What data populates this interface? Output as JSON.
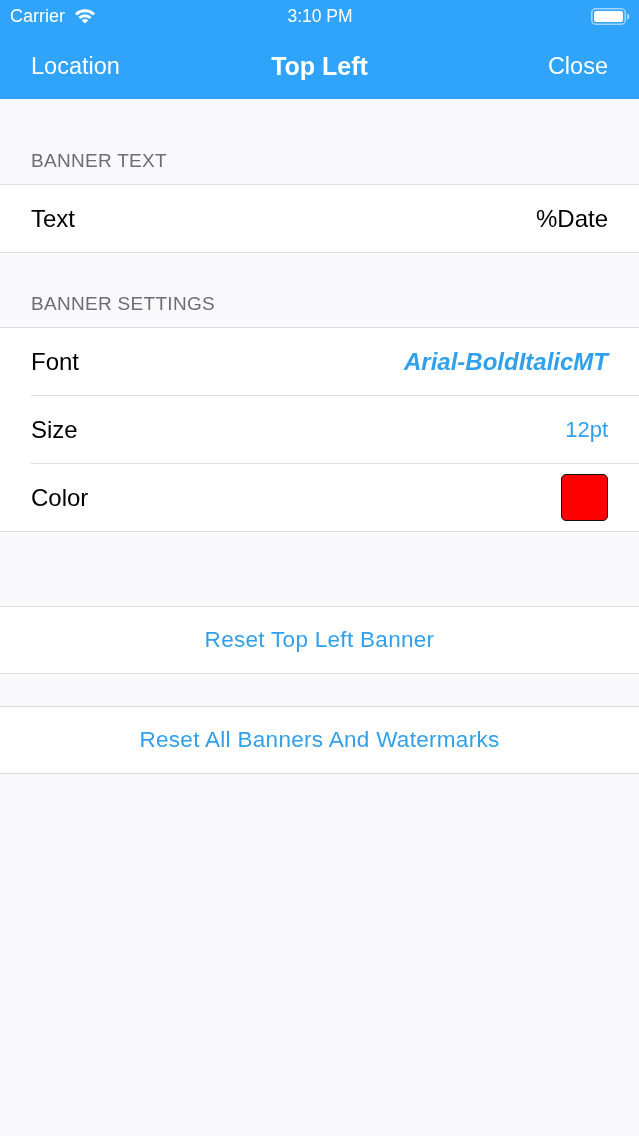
{
  "status_bar": {
    "carrier": "Carrier",
    "time": "3:10 PM"
  },
  "nav_bar": {
    "back": "Location",
    "title": "Top Left",
    "close": "Close"
  },
  "sections": [
    {
      "header": "BANNER TEXT",
      "rows": [
        {
          "kind": "text",
          "label": "Text",
          "value": "%Date"
        }
      ]
    },
    {
      "header": "BANNER SETTINGS",
      "rows": [
        {
          "kind": "font",
          "label": "Font",
          "value": "Arial-BoldItalicMT"
        },
        {
          "kind": "size",
          "label": "Size",
          "value": "12pt"
        },
        {
          "kind": "color",
          "label": "Color",
          "color": "#ff0000"
        }
      ]
    }
  ],
  "actions": [
    {
      "label": "Reset Top Left Banner"
    },
    {
      "label": "Reset All Banners And Watermarks"
    }
  ]
}
